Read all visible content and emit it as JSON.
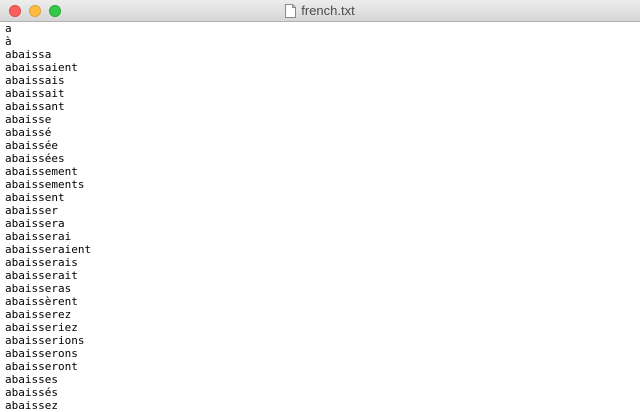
{
  "window": {
    "title": "french.txt",
    "document_icon": "text-document-icon"
  },
  "editor": {
    "lines": [
      "a",
      "à",
      "abaissa",
      "abaissaient",
      "abaissais",
      "abaissait",
      "abaissant",
      "abaisse",
      "abaissé",
      "abaissée",
      "abaissées",
      "abaissement",
      "abaissements",
      "abaissent",
      "abaisser",
      "abaissera",
      "abaisserai",
      "abaisseraient",
      "abaisserais",
      "abaisserait",
      "abaisseras",
      "abaissèrent",
      "abaisserez",
      "abaisseriez",
      "abaisserions",
      "abaisserons",
      "abaisseront",
      "abaisses",
      "abaissés",
      "abaissez"
    ]
  },
  "colors": {
    "close": "#fc605c",
    "minimize": "#fdbc40",
    "zoom": "#34c84a"
  }
}
